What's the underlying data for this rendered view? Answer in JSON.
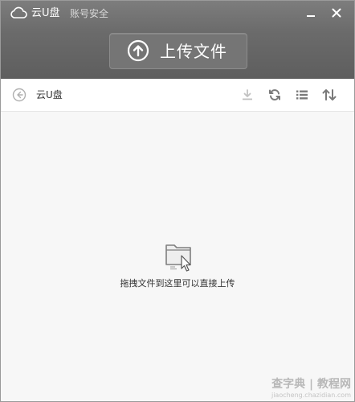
{
  "titlebar": {
    "app_title": "云U盘",
    "account_link": "账号安全"
  },
  "header": {
    "upload_label": "上传文件"
  },
  "toolbar": {
    "breadcrumb": "云U盘"
  },
  "content": {
    "drop_hint": "拖拽文件到这里可以直接上传"
  },
  "watermark": {
    "main": "查字典 | 教程网",
    "sub": "jiaocheng.chazidian.com"
  },
  "icons": {
    "logo": "cloud-icon",
    "minimize": "minimize-icon",
    "close": "close-icon",
    "upload": "upload-arrow-icon",
    "back": "back-arrow-icon",
    "download": "download-icon",
    "refresh": "refresh-icon",
    "list": "list-view-icon",
    "sort": "sort-icon",
    "drop": "folder-drop-icon"
  },
  "colors": {
    "header_bg": "#6b6b6b",
    "upload_button_bg": "#757575",
    "content_bg": "#f7f7f7",
    "text_dark": "#333333",
    "icon_gray": "#8a8a8a"
  }
}
